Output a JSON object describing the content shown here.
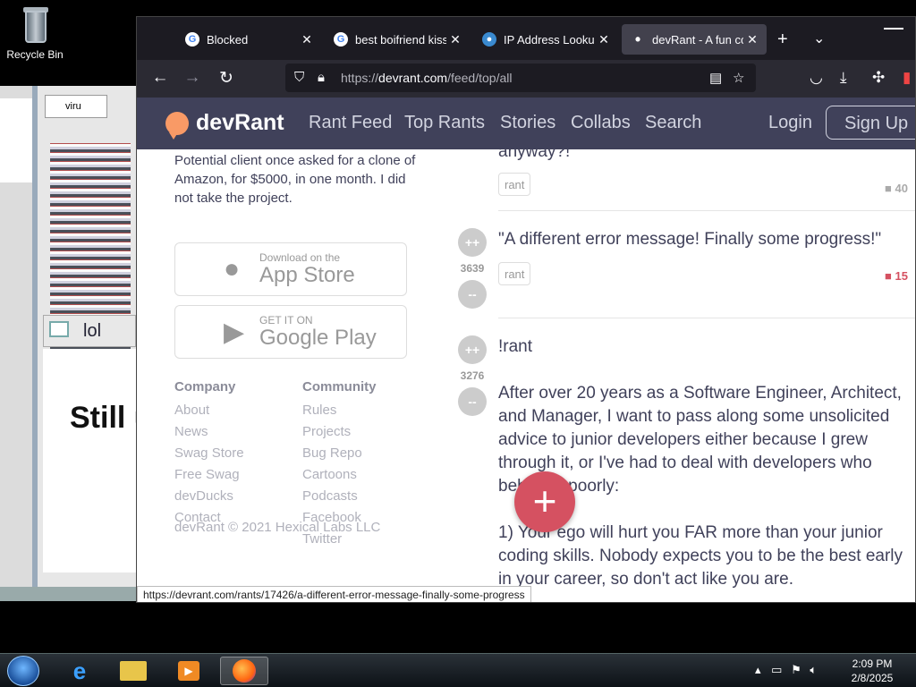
{
  "desktop": {
    "recycle_bin_label": "Recycle Bin"
  },
  "bg_window": {
    "tab_text": "viru",
    "lol_text": "lol",
    "still_text": "Still u"
  },
  "tabs": [
    {
      "title": "Blocked",
      "favicon": "google-icon"
    },
    {
      "title": "best boifriend kissin",
      "favicon": "google-icon"
    },
    {
      "title": "IP Address Lookup f",
      "favicon": "globe-icon"
    },
    {
      "title": "devRant - A fun com",
      "favicon": "dot-icon"
    }
  ],
  "url": {
    "prefix": "https://",
    "host": "devrant.com",
    "path": "/feed/top/all"
  },
  "site": {
    "logo": "devRant",
    "nav": [
      "Rant Feed",
      "Top Rants",
      "Stories",
      "Collabs",
      "Search"
    ],
    "login": "Login",
    "signup": "Sign Up"
  },
  "sidebar": {
    "intro": "Potential client once asked for a clone of Amazon, for $5000, in one month. I did not take the project.",
    "appstore": {
      "small": "Download on the",
      "big": "App Store"
    },
    "googleplay": {
      "small": "GET IT ON",
      "big": "Google Play"
    },
    "company": {
      "heading": "Company",
      "links": [
        "About",
        "News",
        "Swag Store",
        "Free Swag",
        "devDucks",
        "Contact"
      ]
    },
    "community": {
      "heading": "Community",
      "links": [
        "Rules",
        "Projects",
        "Bug Repo",
        "Cartoons",
        "Podcasts",
        "Facebook",
        "Twitter"
      ]
    },
    "copyright": "devRant © 2021 Hexical Labs LLC"
  },
  "rants": [
    {
      "text": "anyway?!",
      "tag": "rant",
      "comments": "40"
    },
    {
      "text": "\"A different error message! Finally some progress!\"",
      "score": "3639",
      "tag": "rant",
      "comments": "15",
      "up": "++",
      "down": "--"
    },
    {
      "title": "!rant",
      "score": "3276",
      "up": "++",
      "down": "--",
      "body": "After over 20 years as a Software Engineer, Architect, and Manager, I want to pass along some unsolicited advice to junior developers either because I grew through it, or I've had to deal with developers who behaved poorly:",
      "body2": "1) Your ego will hurt you FAR more than your junior coding skills. Nobody expects you to be the best early in your career, so don't act like you are."
    }
  ],
  "fab": "+",
  "status_url": "https://devrant.com/rants/17426/a-different-error-message-finally-some-progress",
  "clock": {
    "time": "2:09 PM",
    "date": "2/8/2025"
  },
  "colors": {
    "header": "#40415a",
    "accent": "#d55161",
    "logo_bubble": "#f99a66"
  }
}
